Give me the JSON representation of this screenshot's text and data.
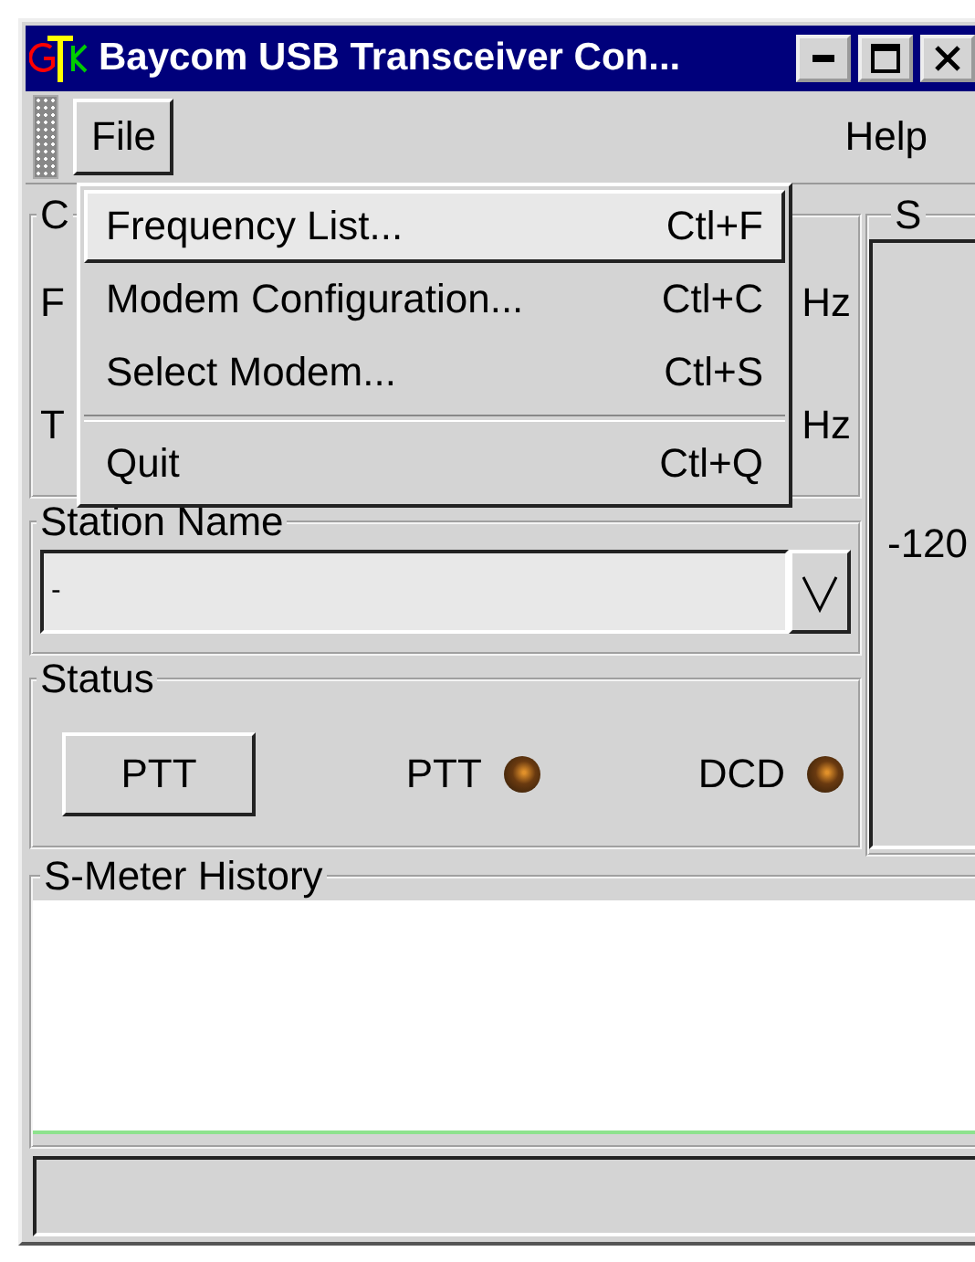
{
  "window": {
    "title": "Baycom USB Transceiver Con..."
  },
  "menubar": [
    {
      "label": "File",
      "selected": true
    },
    {
      "label": "Help",
      "selected": false
    }
  ],
  "menu": {
    "items": [
      {
        "kind": "item",
        "label": "Frequency List...",
        "shortcut": "Ctl+F",
        "selected": true
      },
      {
        "kind": "item",
        "label": "Modem Configuration...",
        "shortcut": "Ctl+C",
        "selected": false
      },
      {
        "kind": "item",
        "label": "Select Modem...",
        "shortcut": "Ctl+S",
        "selected": false
      },
      {
        "kind": "separator"
      },
      {
        "kind": "item",
        "label": "Quit",
        "shortcut": "Ctl+Q",
        "selected": false
      }
    ]
  },
  "frequency_frame": {
    "title": "C",
    "rows": [
      {
        "label": "F",
        "unit": "Hz"
      },
      {
        "label": "T",
        "unit": "Hz"
      }
    ]
  },
  "station_name": {
    "title": "Station Name",
    "value": "-"
  },
  "status": {
    "title": "Status",
    "button": "PTT",
    "indicators": [
      {
        "label": "PTT",
        "on": false
      },
      {
        "label": "DCD",
        "on": false
      }
    ]
  },
  "s_meter": {
    "title": "S",
    "reading": "-120"
  },
  "history": {
    "title": "S-Meter History"
  }
}
